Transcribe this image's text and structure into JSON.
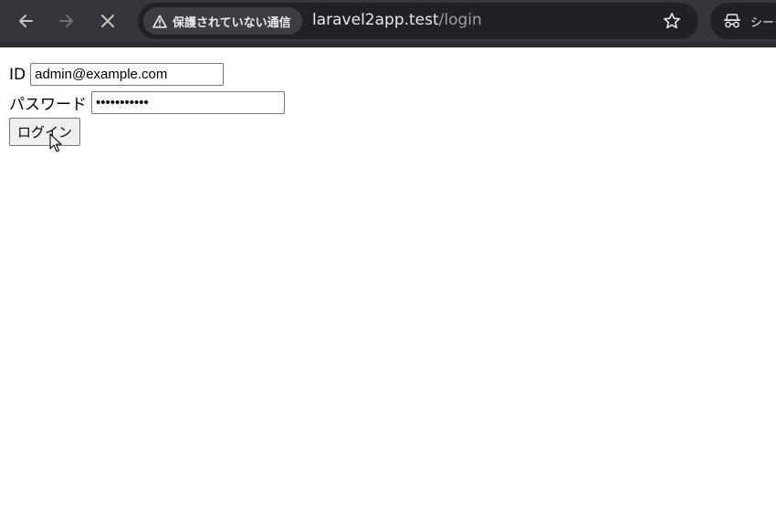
{
  "browser": {
    "security_label": "保護されていない通信",
    "url_host": "laravel2app.test",
    "url_path": "/login",
    "profile_label": "シーク",
    "colors": {
      "toolbar_bg": "#35363a",
      "omnibox_bg": "#202124",
      "text": "#e8eaed",
      "path_text": "#9aa0a6"
    },
    "icons": [
      "arrow-left-icon",
      "arrow-right-icon",
      "close-icon",
      "warning-icon",
      "star-icon",
      "incognito-icon"
    ]
  },
  "form": {
    "id_label": "ID",
    "id_value": "admin@example.com",
    "password_label": "パスワード",
    "password_value": "•••••••••••",
    "submit_label": "ログイン"
  }
}
